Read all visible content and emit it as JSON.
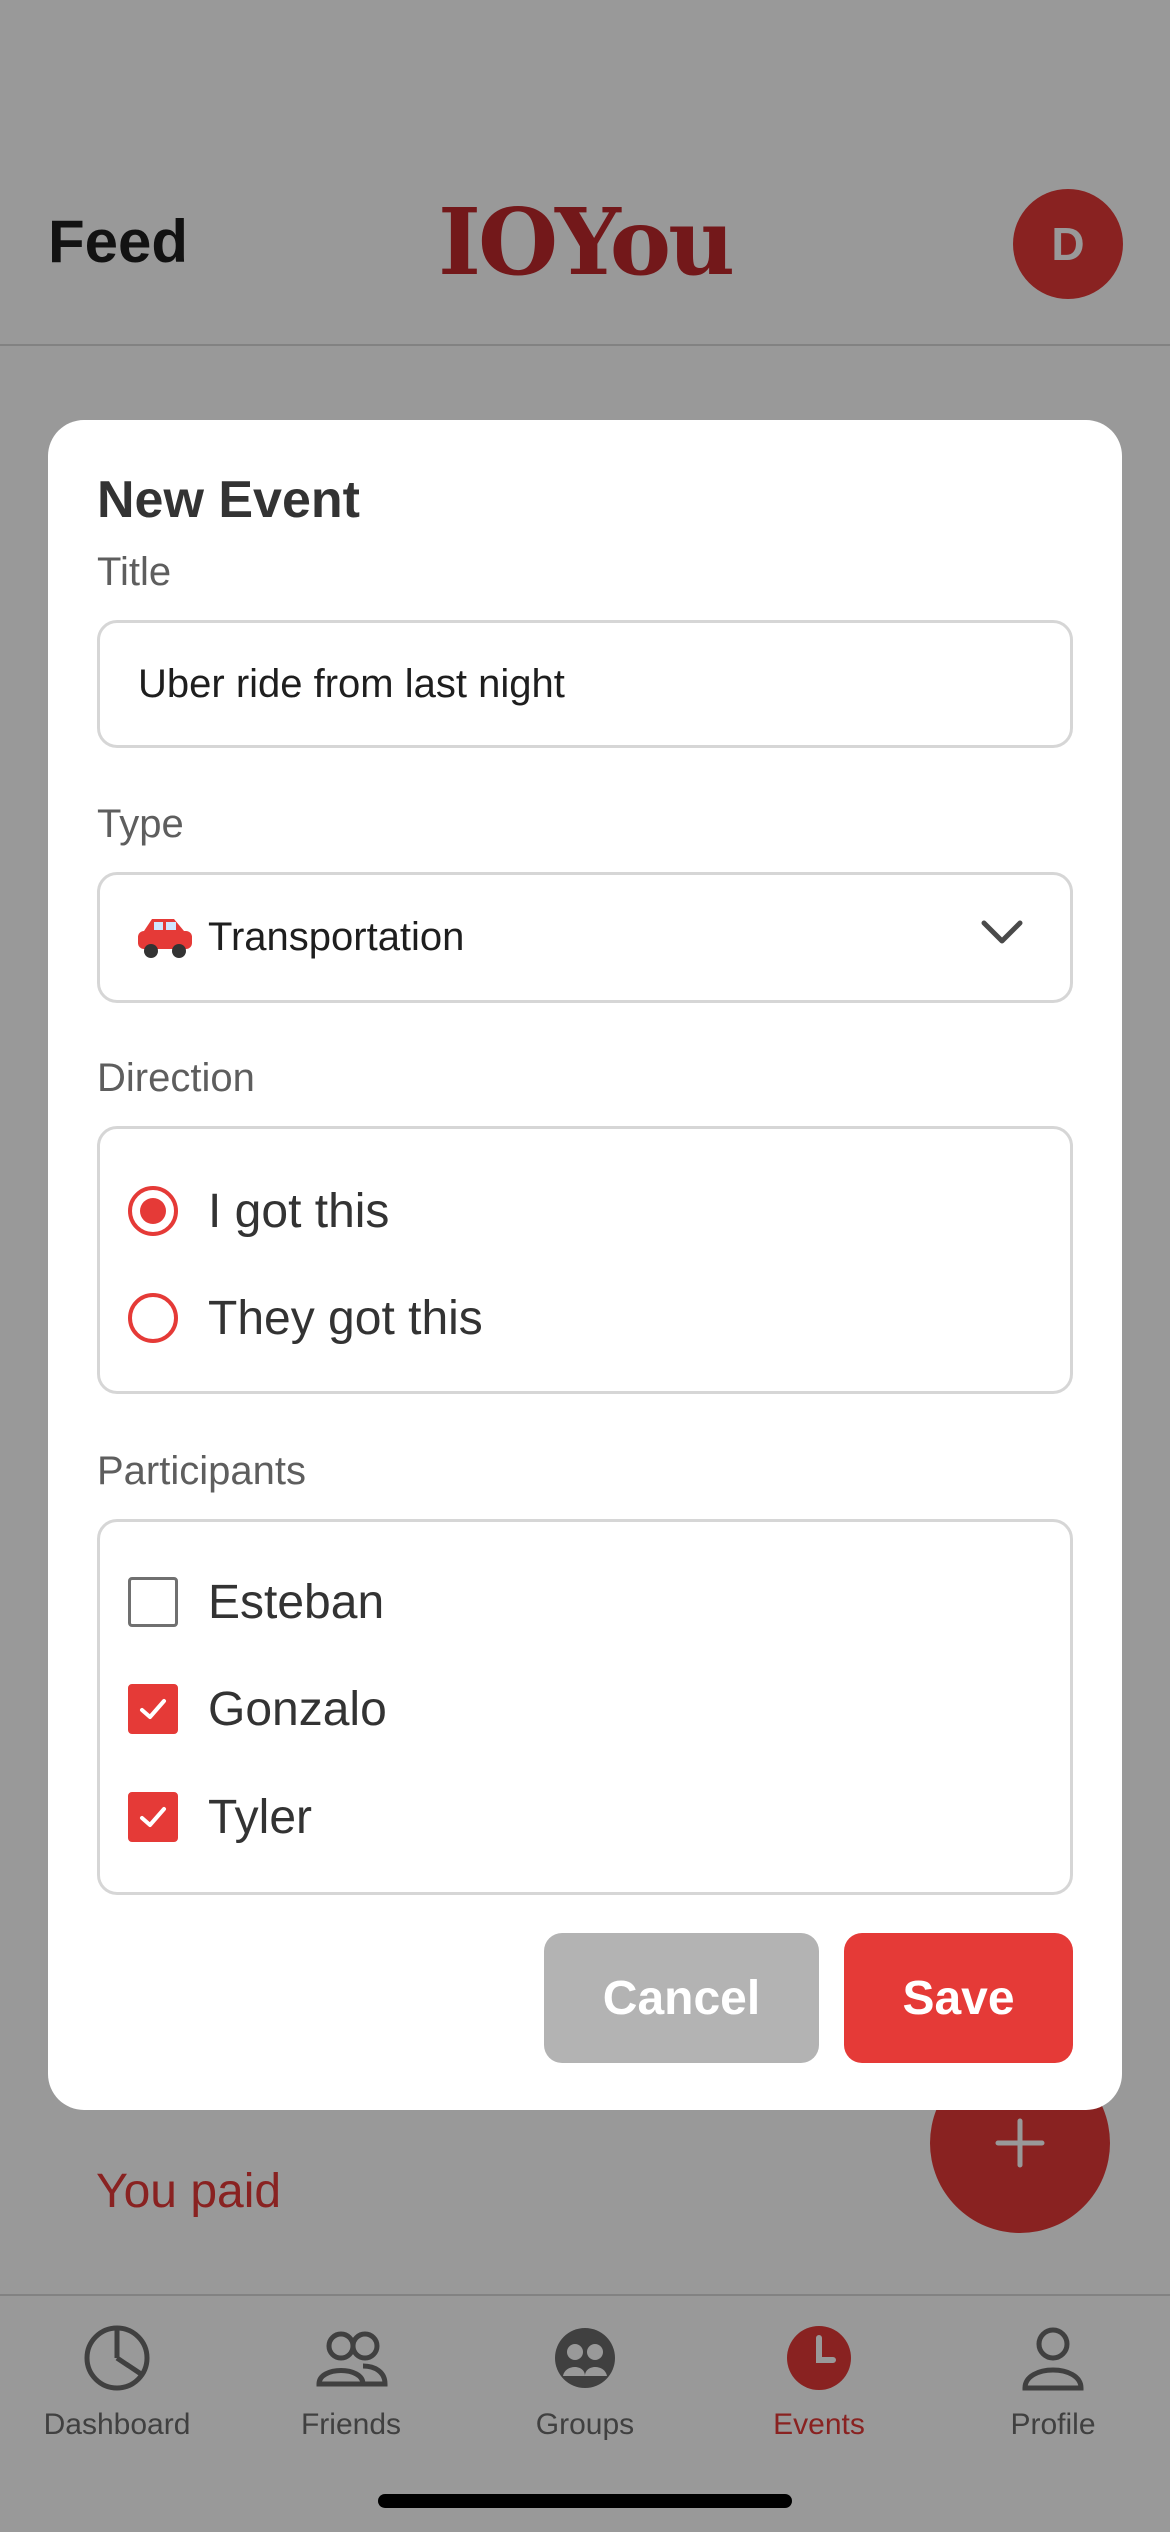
{
  "header": {
    "title": "Feed",
    "logo_text": "IOYou",
    "avatar_initial": "D"
  },
  "feed": {
    "visible_text": "You paid"
  },
  "fab": {
    "icon": "plus-icon"
  },
  "modal": {
    "title": "New Event",
    "title_label": "Title",
    "title_value": "Uber ride from last night",
    "type_label": "Type",
    "type_value": "Transportation",
    "type_icon": "red-car-emoji",
    "direction_label": "Direction",
    "direction_options": [
      {
        "label": "I got this",
        "selected": true
      },
      {
        "label": "They got this",
        "selected": false
      }
    ],
    "participants_label": "Participants",
    "participants": [
      {
        "name": "Esteban",
        "checked": false
      },
      {
        "name": "Gonzalo",
        "checked": true
      },
      {
        "name": "Tyler",
        "checked": true
      }
    ],
    "cancel_label": "Cancel",
    "save_label": "Save"
  },
  "tabbar": {
    "tabs": [
      {
        "label": "Dashboard",
        "icon": "pie-chart-icon",
        "active": false
      },
      {
        "label": "Friends",
        "icon": "users-icon",
        "active": false
      },
      {
        "label": "Groups",
        "icon": "group-icon",
        "active": false
      },
      {
        "label": "Events",
        "icon": "clock-icon",
        "active": true
      },
      {
        "label": "Profile",
        "icon": "user-icon",
        "active": false
      }
    ]
  },
  "colors": {
    "accent": "#e53a37",
    "logo": "#c0282c",
    "cancel": "#b3b3b3"
  }
}
